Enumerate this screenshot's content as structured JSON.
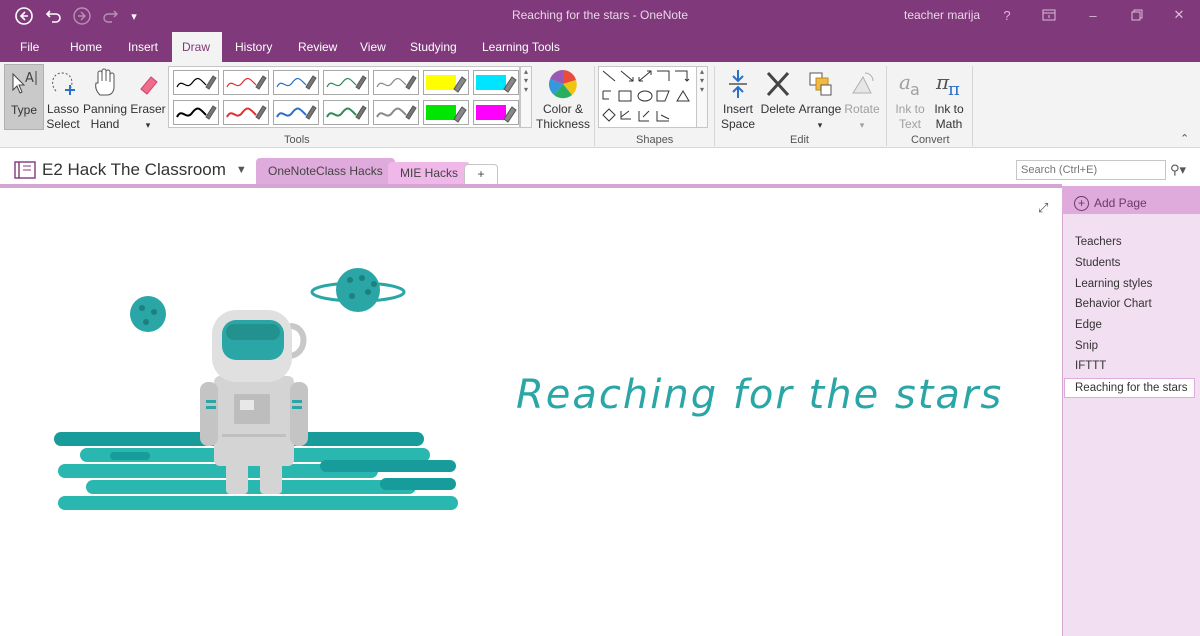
{
  "window": {
    "title": "Reaching for the stars - OneNote",
    "user": "teacher marija",
    "help": "?"
  },
  "menu": {
    "tabs": [
      "File",
      "Home",
      "Insert",
      "Draw",
      "History",
      "Review",
      "View",
      "Studying",
      "Learning Tools"
    ],
    "active": "Draw"
  },
  "ribbon": {
    "type_label": "Type",
    "lasso_label1": "Lasso",
    "lasso_label2": "Select",
    "panning_label1": "Panning",
    "panning_label2": "Hand",
    "eraser_label": "Eraser",
    "color_label1": "Color &",
    "color_label2": "Thickness",
    "tools_group": "Tools",
    "shapes_group": "Shapes",
    "insert_space1": "Insert",
    "insert_space2": "Space",
    "delete_label": "Delete",
    "arrange_label": "Arrange",
    "rotate_label": "Rotate",
    "edit_group": "Edit",
    "ink_text1": "Ink to",
    "ink_text2": "Text",
    "ink_math1": "Ink to",
    "ink_math2": "Math",
    "convert_group": "Convert",
    "pen_colors": [
      "#000000",
      "#e03030",
      "#2a6fc9",
      "#2e8b57",
      "#888888",
      "#ffff00",
      "#00e5ff"
    ],
    "pen_colors_row2": [
      "#000000",
      "#e03030",
      "#2a6fc9",
      "#2e8b57",
      "#888888",
      "#00e600",
      "#ff00ff"
    ]
  },
  "notebook": {
    "name": "E2 Hack The Classroom",
    "sections": [
      "OneNoteClass Hacks",
      "MIE Hacks"
    ],
    "add_section": "+",
    "search_placeholder": "Search (Ctrl+E)"
  },
  "pages": {
    "add_page": "Add Page",
    "items": [
      "Teachers",
      "Students",
      "Learning styles",
      "Behavior Chart",
      "Edge",
      "Snip",
      "IFTTT",
      "Reaching for the stars"
    ],
    "selected": "Reaching for the stars"
  },
  "canvas": {
    "heading": "Reaching for the stars"
  },
  "colors": {
    "brand": "#80397b",
    "accent_teal": "#2aa6a6",
    "pages_bg": "#f2dff1"
  }
}
